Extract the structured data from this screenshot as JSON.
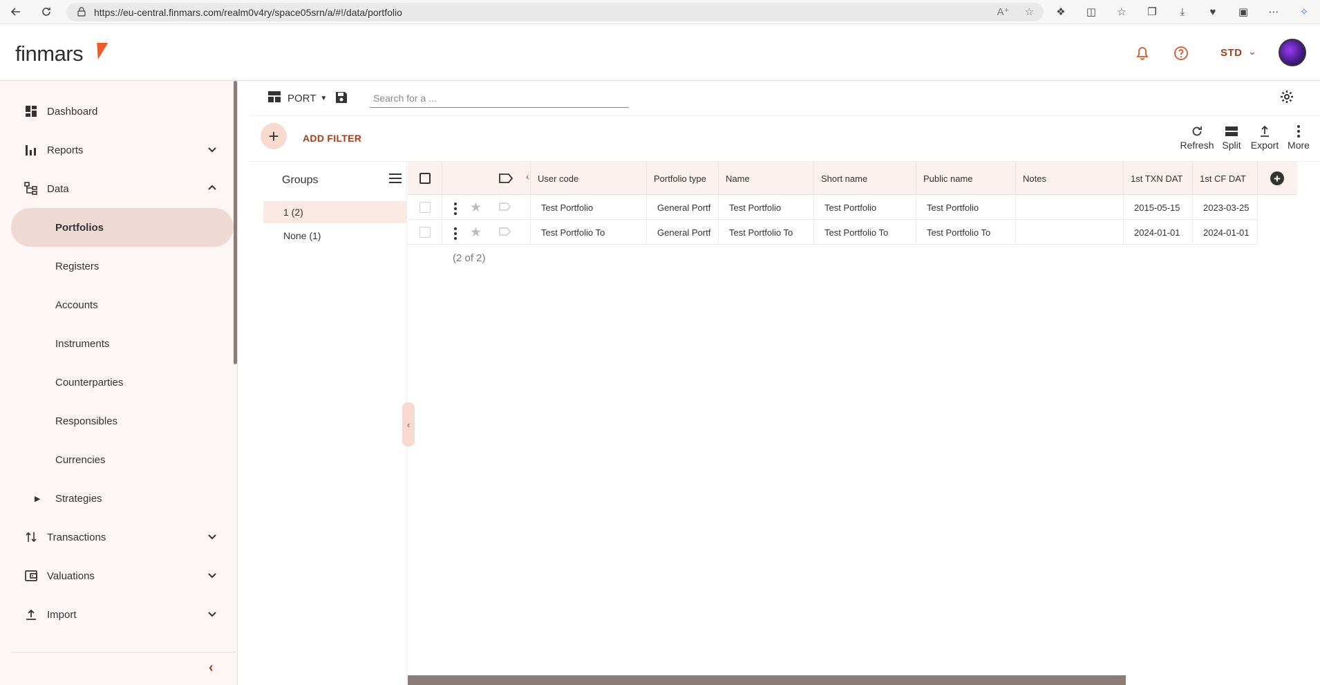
{
  "browser": {
    "url": "https://eu-central.finmars.com/realm0v4ry/space05srn/a/#!/data/portfolio"
  },
  "header": {
    "logo_text": "finmars",
    "user_role": "STD",
    "accent_color": "#a33d1d",
    "brand_color": "#f05a28"
  },
  "sidebar": {
    "items": [
      {
        "label": "Dashboard",
        "icon": "dashboard-icon"
      },
      {
        "label": "Reports",
        "icon": "bar-chart-icon"
      },
      {
        "label": "Data",
        "icon": "tree-icon"
      },
      {
        "label": "Portfolios"
      },
      {
        "label": "Registers"
      },
      {
        "label": "Accounts"
      },
      {
        "label": "Instruments"
      },
      {
        "label": "Counterparties"
      },
      {
        "label": "Responsibles"
      },
      {
        "label": "Currencies"
      },
      {
        "label": "Strategies"
      },
      {
        "label": "Transactions",
        "icon": "swap-vertical-icon"
      },
      {
        "label": "Valuations",
        "icon": "wallet-icon"
      },
      {
        "label": "Import",
        "icon": "upload-icon"
      }
    ]
  },
  "toolbar": {
    "layout_name": "PORT",
    "search_placeholder": "Search for a ...",
    "add_filter": "ADD FILTER",
    "refresh": "Refresh",
    "split": "Split",
    "export": "Export",
    "more": "More"
  },
  "groups": {
    "title": "Groups",
    "items": [
      {
        "label": "1 (2)",
        "selected": true
      },
      {
        "label": "None (1)",
        "selected": false
      }
    ]
  },
  "table": {
    "columns": [
      "User code",
      "Portfolio type",
      "Name",
      "Short name",
      "Public name",
      "Notes",
      "1st TXN DAT",
      "1st CF DAT"
    ],
    "rows": [
      [
        "Test Portfolio",
        "General Portf",
        "Test Portfolio",
        "Test Portfolio",
        "Test Portfolio",
        "",
        "2015-05-15",
        "2023-03-25"
      ],
      [
        "Test Portfolio To",
        "General Portf",
        "Test Portfolio To",
        "Test Portfolio To",
        "Test Portfolio To",
        "",
        "2024-01-01",
        "2024-01-01"
      ]
    ],
    "count_label": "(2 of 2)"
  }
}
